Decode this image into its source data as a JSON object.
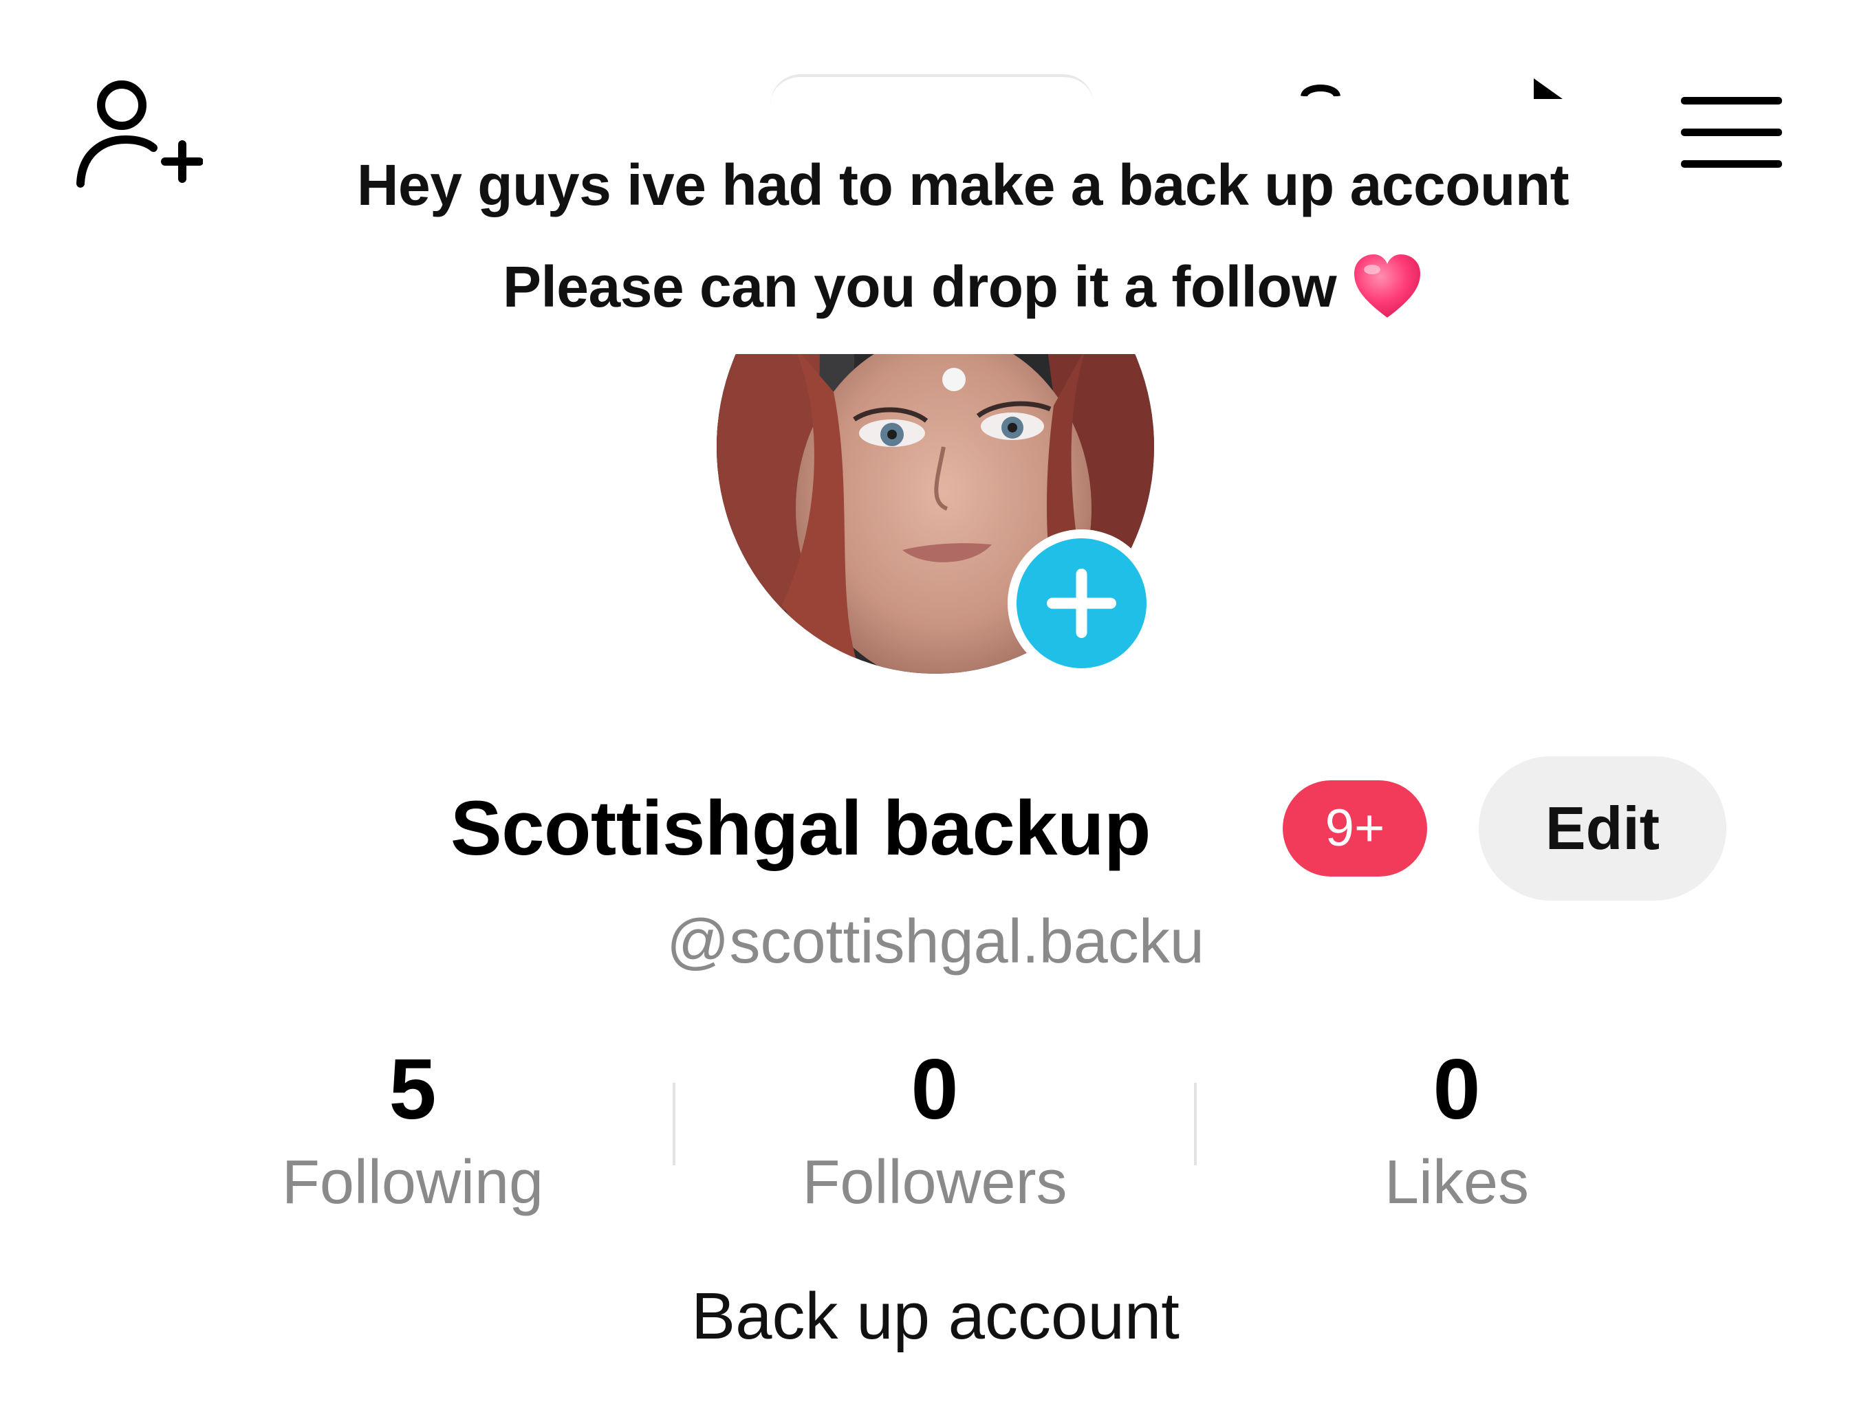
{
  "top_bar": {
    "add_friend_icon": "person-add-icon",
    "menu_icon": "hamburger-menu-icon"
  },
  "caption": {
    "line1": "Hey guys ive had to make a back up account",
    "line2": "Please can you drop it a follow",
    "emoji": "heart-emoji"
  },
  "profile": {
    "display_name": "Scottishgal backup",
    "notification_badge": "9+",
    "edit_label": "Edit",
    "username": "@scottishgal.backu",
    "bio": "Back up account"
  },
  "stats": [
    {
      "value": "5",
      "label": "Following"
    },
    {
      "value": "0",
      "label": "Followers"
    },
    {
      "value": "0",
      "label": "Likes"
    }
  ],
  "colors": {
    "badge": "#f23b5a",
    "add_photo": "#20bfe8",
    "muted_text": "#8a8a8a",
    "edit_bg": "#efefef"
  }
}
